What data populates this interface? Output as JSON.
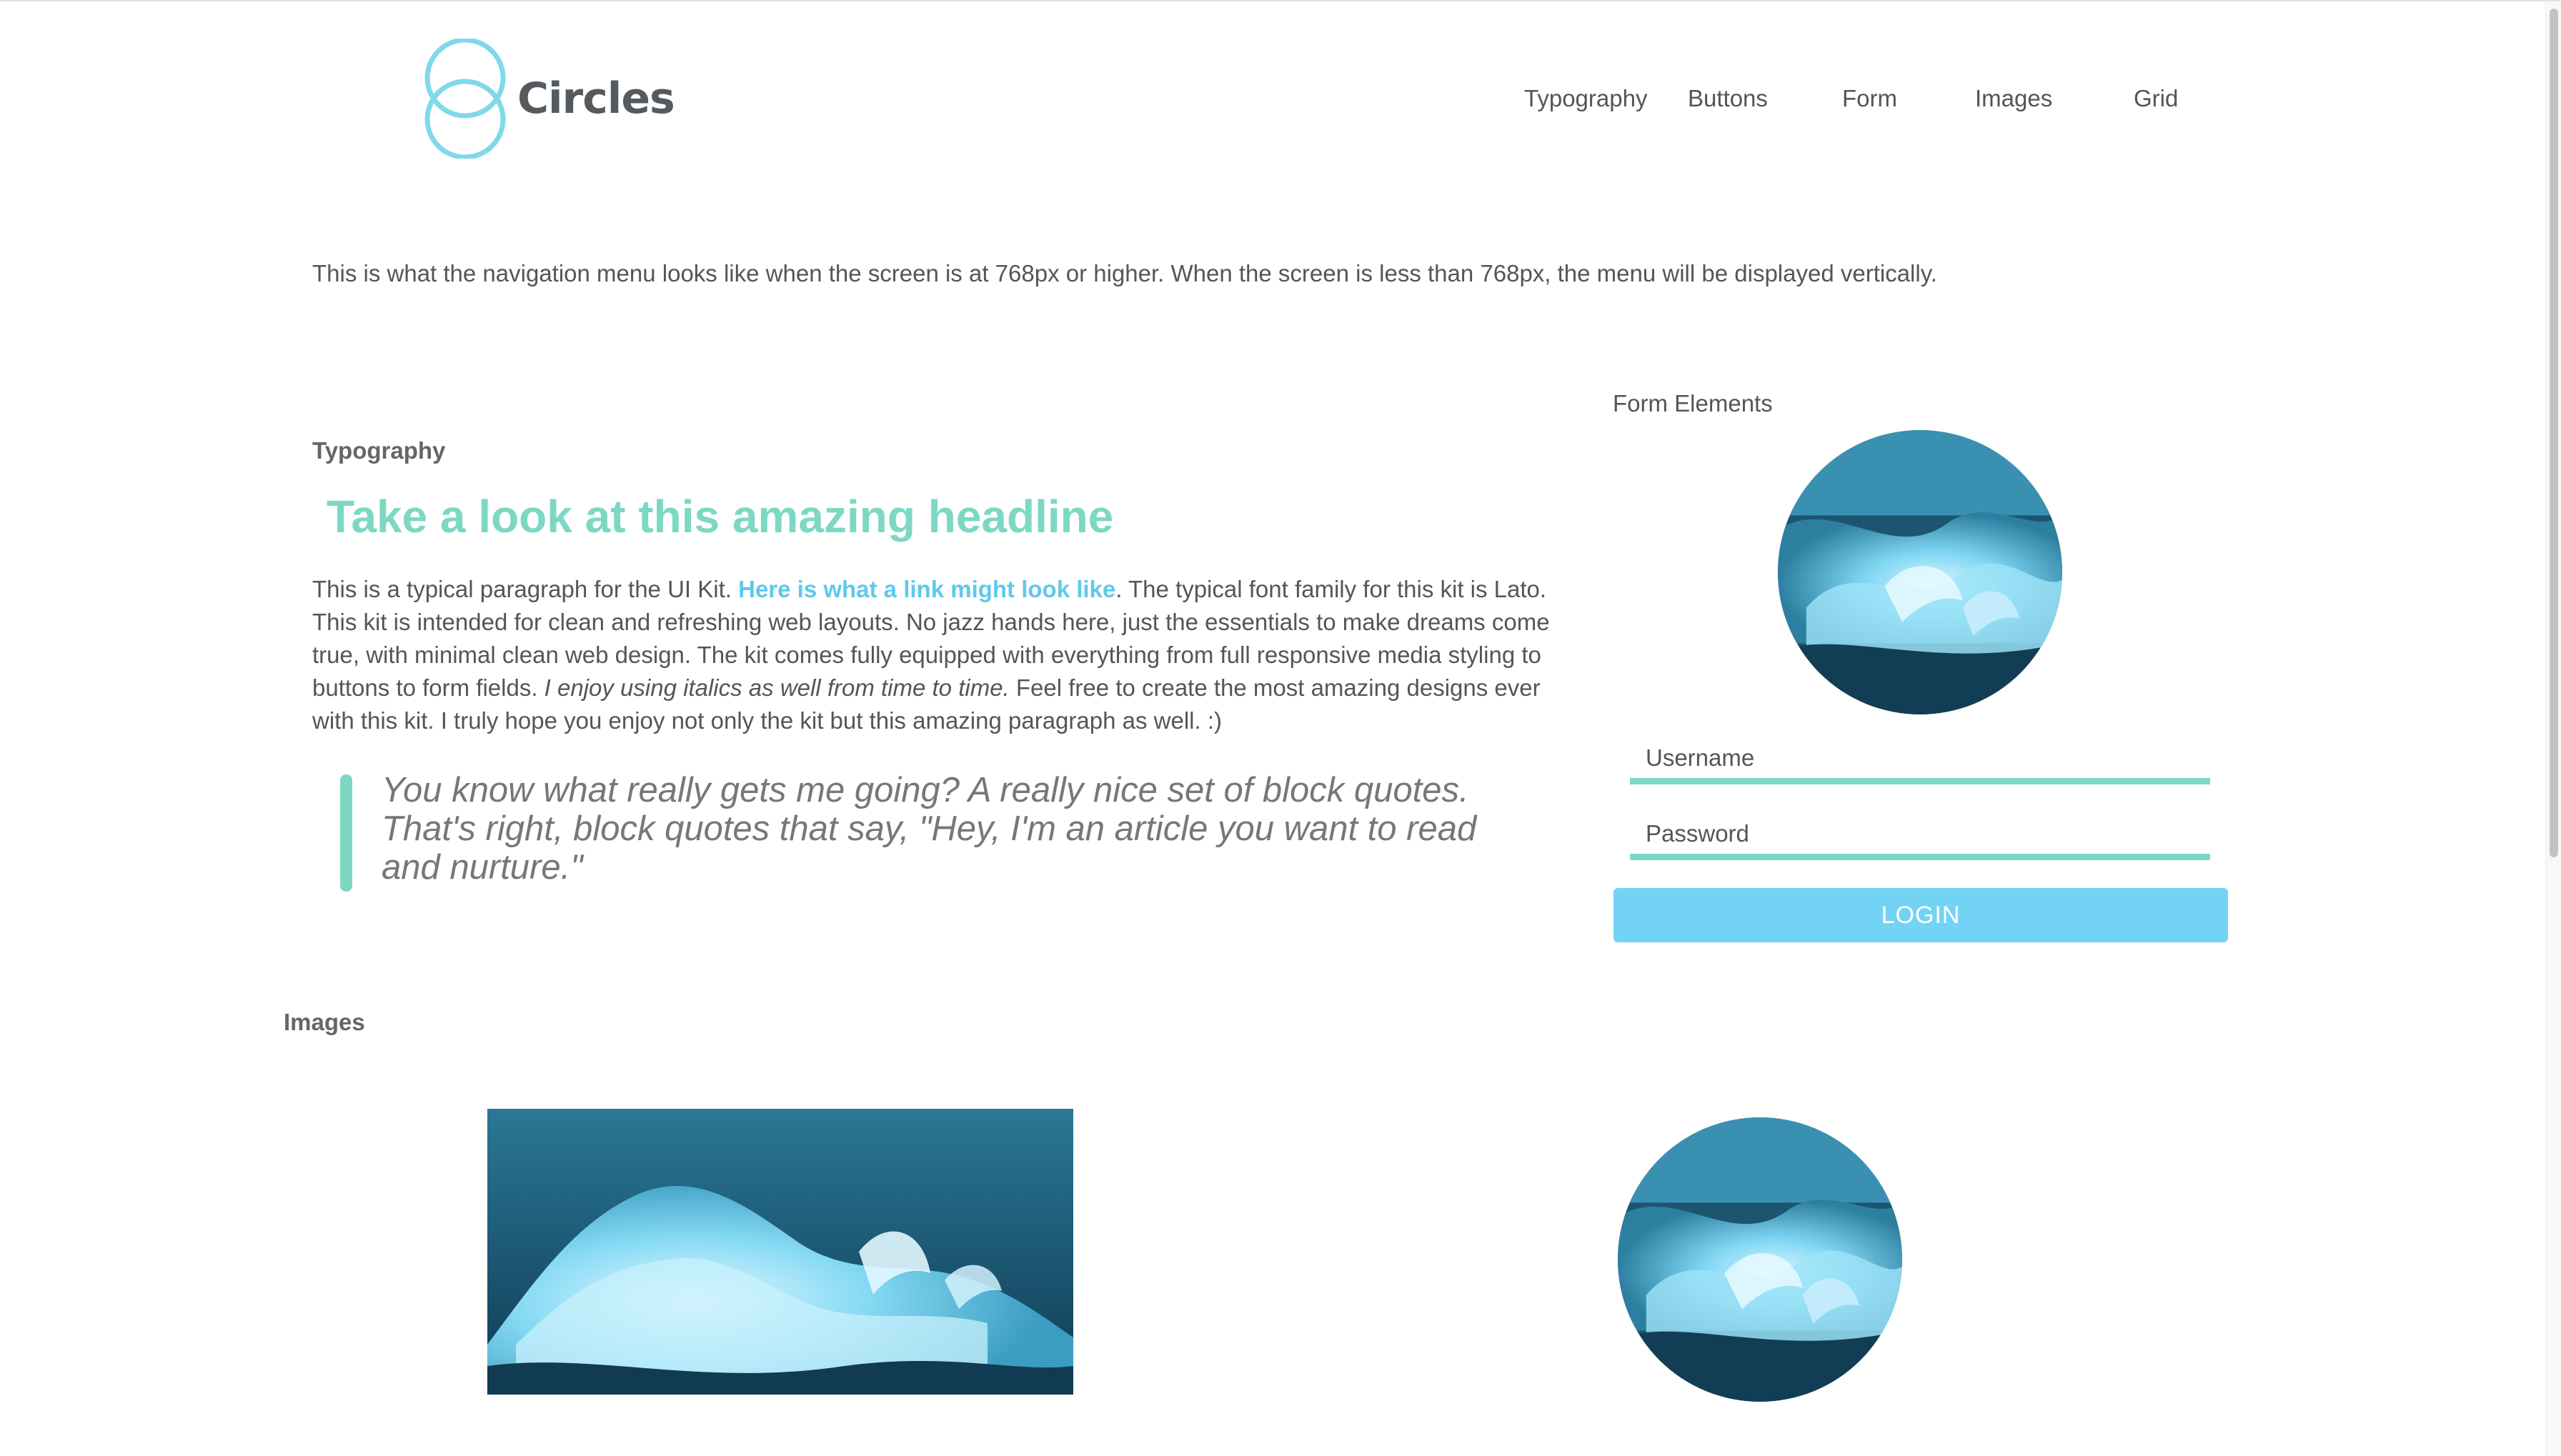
{
  "brand": {
    "name": "Circles",
    "logo_icon": "two-overlapping-circles-icon",
    "accent_color": "#7cd8c3",
    "link_color": "#60c8ea",
    "button_color": "#73d3f5"
  },
  "nav": {
    "items": [
      {
        "label": "Typography"
      },
      {
        "label": "Buttons"
      },
      {
        "label": "Form"
      },
      {
        "label": "Images"
      },
      {
        "label": "Grid"
      }
    ]
  },
  "intro": {
    "text": "This is what the navigation menu looks like when the screen is at 768px or higher. When the screen is less than 768px, the menu will be displayed vertically."
  },
  "typography": {
    "label": "Typography",
    "headline": "Take a look at this amazing headline",
    "paragraph": {
      "part1": "This is a typical paragraph for the UI Kit. ",
      "link": "Here is what a link might look like",
      "part2": ". The typical font family for this kit is Lato. This kit is intended for clean and refreshing web layouts. No jazz hands here, just the essentials to make dreams come true, with minimal clean web design. The kit comes fully equipped with everything from full responsive media styling to buttons to form fields. ",
      "italic": "I enjoy using italics as well from time to time.",
      "part3": " Feel free to create the most amazing designs ever with this kit. I truly hope you enjoy not only the kit but this amazing paragraph as well. :)"
    },
    "blockquote": "You know what really gets me going? A really nice set of block quotes. That's right, block quotes that say, \"Hey, I'm an article you want to read and nurture.\""
  },
  "form": {
    "label": "Form Elements",
    "username_placeholder": "Username",
    "password_placeholder": "Password",
    "login_label": "LOGIN"
  },
  "images": {
    "label": "Images"
  }
}
